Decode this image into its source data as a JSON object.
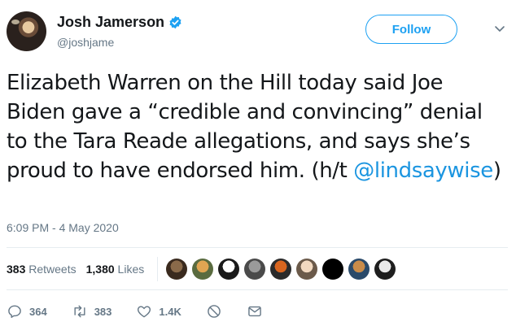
{
  "author": {
    "display_name": "Josh Jamerson",
    "handle": "@joshjame",
    "verified_icon": "verified-badge-icon"
  },
  "follow_label": "Follow",
  "tweet": {
    "text_before": "Elizabeth Warren on the Hill today said  Joe Biden gave a “credible and convincing” denial to the Tara Reade allegations, and says she’s proud to have endorsed him. (h/t ",
    "mention": "@lindsaywise",
    "text_after": ")"
  },
  "timestamp": "6:09 PM - 4 May 2020",
  "stats": {
    "retweets_count": "383",
    "retweets_label": "Retweets",
    "likes_count": "1,380",
    "likes_label": "Likes"
  },
  "likers": [
    {
      "colors": [
        "#8a6a4a",
        "#3a2a1e"
      ]
    },
    {
      "colors": [
        "#e0a552",
        "#5a6b3f"
      ]
    },
    {
      "colors": [
        "#ffffff",
        "#1a1a1a"
      ]
    },
    {
      "colors": [
        "#9a9a9a",
        "#4a4a4a"
      ]
    },
    {
      "colors": [
        "#d8651f",
        "#2b2b2b"
      ]
    },
    {
      "colors": [
        "#f2d9c0",
        "#6b5a4a"
      ]
    },
    {
      "colors": [
        "#000000",
        "#000000"
      ]
    },
    {
      "colors": [
        "#c98c4a",
        "#2a4a6a"
      ]
    },
    {
      "colors": [
        "#eaeaea",
        "#1e1e1e"
      ]
    }
  ],
  "actions": {
    "replies": "364",
    "retweets": "383",
    "likes": "1.4K"
  },
  "colors": {
    "accent": "#1da1f2",
    "muted": "#657786",
    "divider": "#e6ecf0"
  }
}
